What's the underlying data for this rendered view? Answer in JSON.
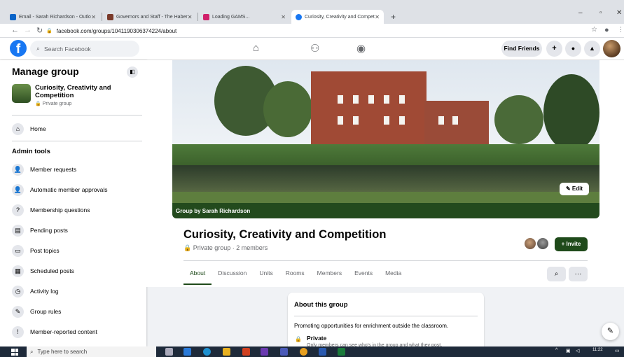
{
  "browser": {
    "tabs": [
      {
        "title": "Email - Sarah Richardson - Outlo",
        "color": "#0a64c8"
      },
      {
        "title": "Governors and Staff - The Haber",
        "color": "#7a3a2a"
      },
      {
        "title": "Loading GAMS...",
        "color": "#d0206a"
      },
      {
        "title": "Curiosity, Creativity and Compet",
        "color": "#1877f2"
      }
    ],
    "new_tab": "+",
    "url": "facebook.com/groups/1041190306374224/about"
  },
  "fb": {
    "search_placeholder": "Search Facebook",
    "find_friends": "Find Friends",
    "brand_color": "#1877f2"
  },
  "sidebar": {
    "title": "Manage group",
    "group_name": "Curiosity, Creativity and Competition",
    "group_privacy": "Private group",
    "home": "Home",
    "admin_tools_label": "Admin tools",
    "admin_items": [
      {
        "label": "Member requests",
        "icon": "person-add-icon"
      },
      {
        "label": "Automatic member approvals",
        "icon": "person-check-icon"
      },
      {
        "label": "Membership questions",
        "icon": "person-question-icon"
      },
      {
        "label": "Pending posts",
        "icon": "pending-posts-icon"
      },
      {
        "label": "Post topics",
        "icon": "post-topics-icon"
      },
      {
        "label": "Scheduled posts",
        "icon": "calendar-icon"
      },
      {
        "label": "Activity log",
        "icon": "clock-icon"
      },
      {
        "label": "Group rules",
        "icon": "rules-icon"
      },
      {
        "label": "Member-reported content",
        "icon": "report-icon"
      }
    ]
  },
  "cover": {
    "banner": "Group by Sarah Richardson",
    "edit": "Edit",
    "banner_color": "#234a1d"
  },
  "group": {
    "title": "Curiosity, Creativity and Competition",
    "subtitle": "Private group · 2 members",
    "invite": "+ Invite",
    "tabs": [
      "About",
      "Discussion",
      "Units",
      "Rooms",
      "Members",
      "Events",
      "Media"
    ],
    "active_tab": "About",
    "more": "···"
  },
  "about": {
    "heading": "About this group",
    "description": "Promoting opportunities for enrichment outside the classroom.",
    "privacy_title": "Private",
    "privacy_desc": "Only members can see who's in the group and what they post."
  },
  "taskbar": {
    "search": "Type here to search",
    "time": "11:22"
  }
}
